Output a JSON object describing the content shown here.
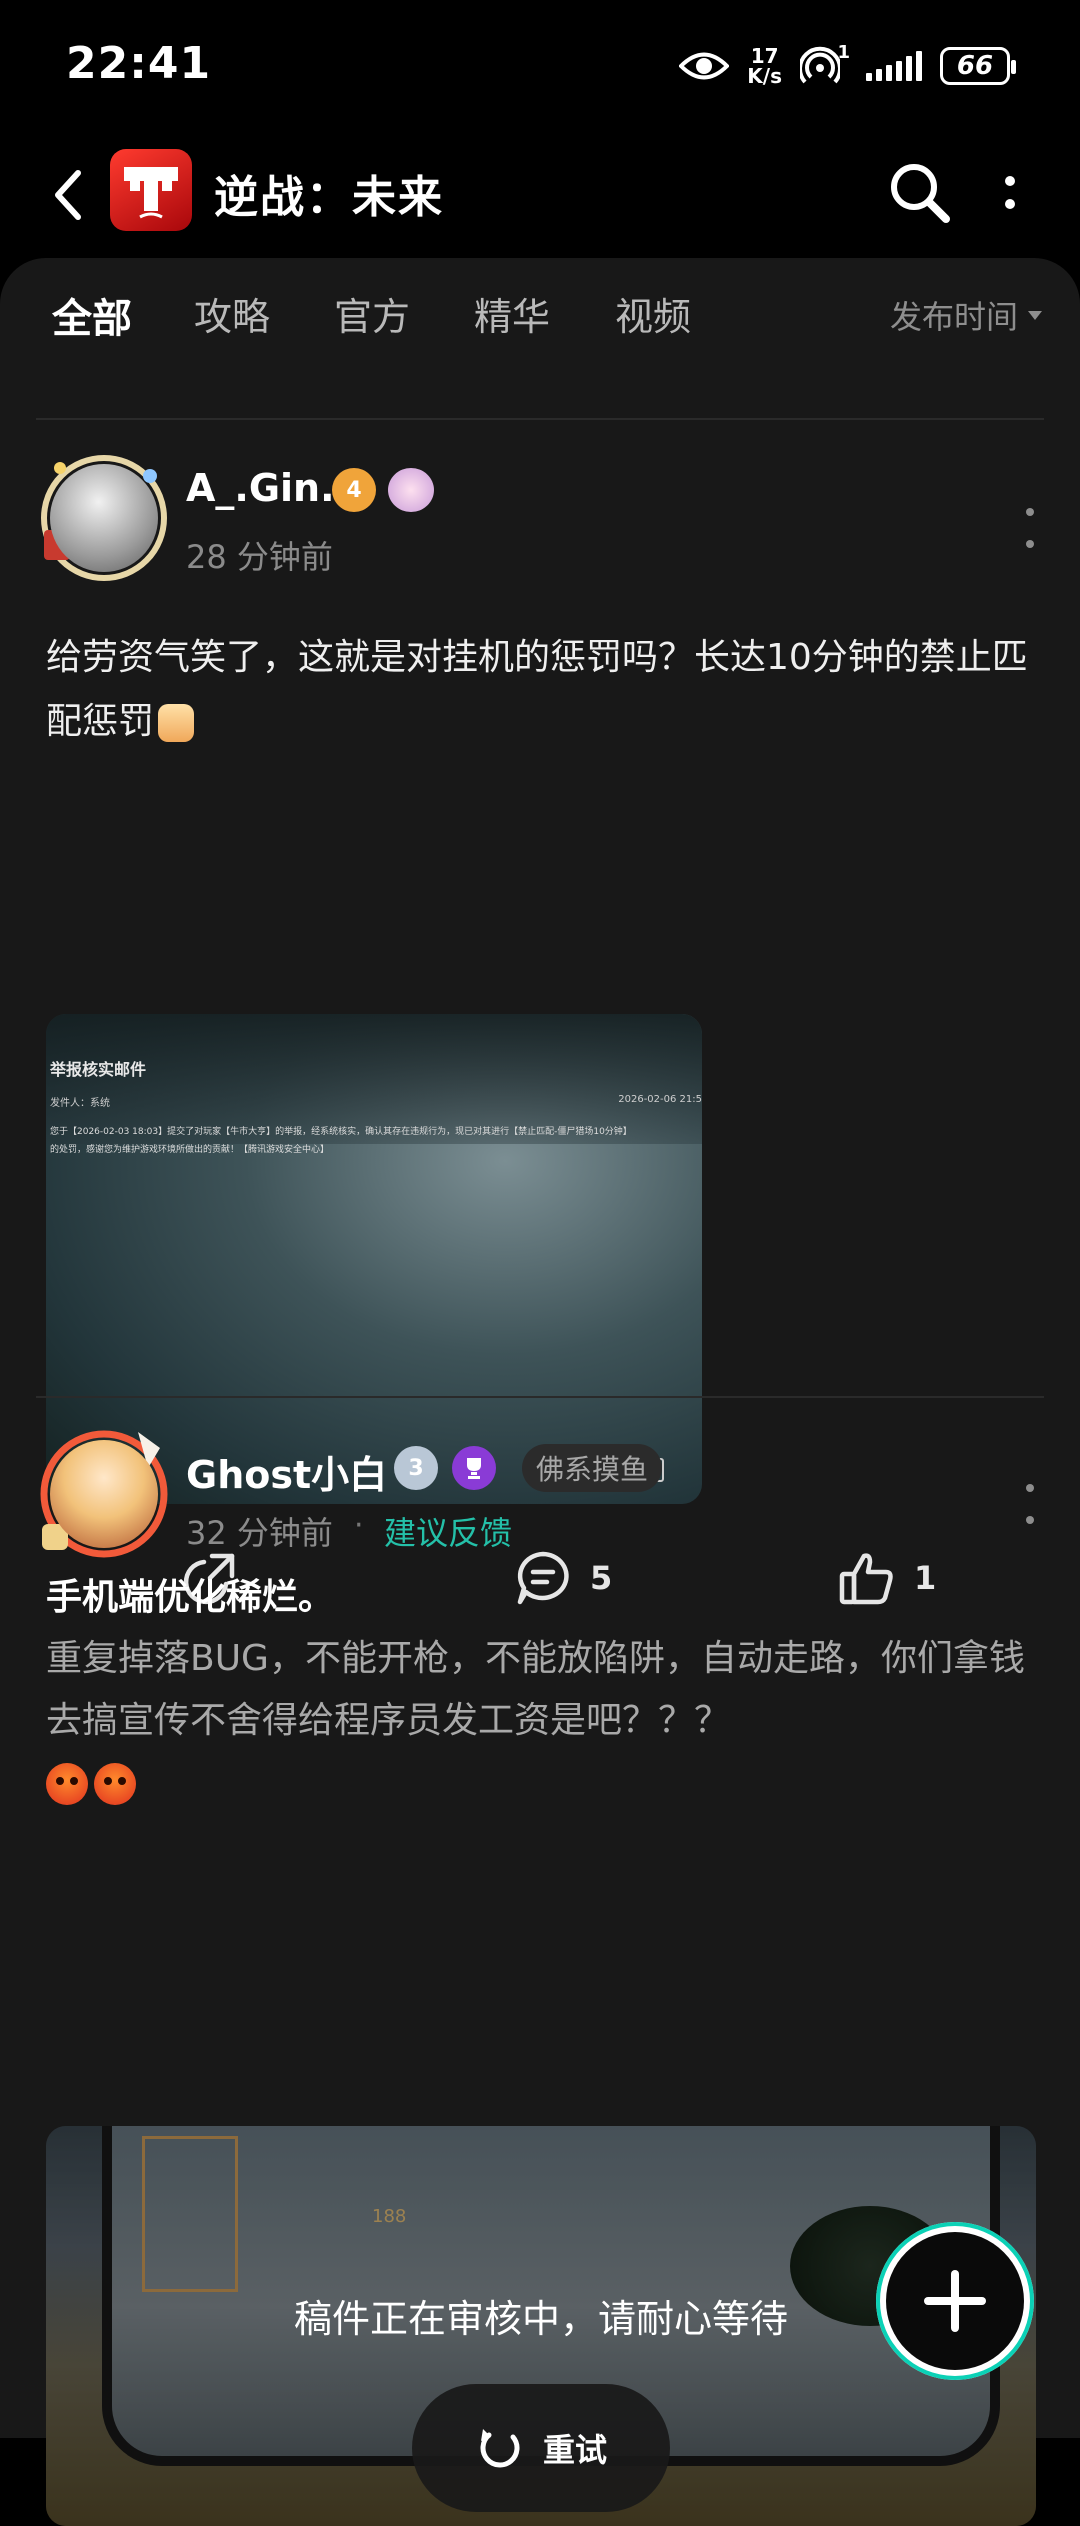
{
  "status_bar": {
    "time": "22:41",
    "net_speed_value": "17",
    "net_speed_unit": "K/s",
    "hotspot_count": "1",
    "battery": "66"
  },
  "header": {
    "title": "逆战：未来"
  },
  "tabs": [
    {
      "label": "全部",
      "active": true
    },
    {
      "label": "攻略",
      "active": false
    },
    {
      "label": "官方",
      "active": false
    },
    {
      "label": "精华",
      "active": false
    },
    {
      "label": "视频",
      "active": false
    }
  ],
  "sort": {
    "label": "发布时间"
  },
  "posts": [
    {
      "username": "A_.Gin.",
      "level": "4",
      "time": "28 分钟前",
      "text": "给劳资气笑了，这就是对挂机的惩罚吗？长达10分钟的禁止匹配惩罚",
      "image": {
        "mail_title": "举报核实邮件",
        "sender": "发件人：系统",
        "date": "2026-02-06 21:5",
        "line1": "您于【2026-02-03 18:03】提交了对玩家【牛市大亨】的举报，经系统核实，确认其存在违规行为，现已对其进行【禁止匹配-僵尸猎场10分钟】",
        "line2": "的处罚，感谢您为维护游戏环境所做出的贡献！【腾讯游戏安全中心】"
      },
      "comments": "5",
      "likes": "1"
    },
    {
      "username": "Ghost小白",
      "level": "3",
      "tag": "佛系摸鱼",
      "time": "32 分钟前",
      "dot": "·",
      "topic": "建议反馈",
      "title": "手机端优化稀烂。",
      "text": "重复掉落BUG，不能开枪，不能放陷阱，自动走路，你们拿钱去搞宣传不舍得给程序员发工资是吧？？？",
      "overlay_message": "稿件正在审核中，请耐心等待",
      "retry_label": "重试",
      "hud_number": "188"
    }
  ]
}
